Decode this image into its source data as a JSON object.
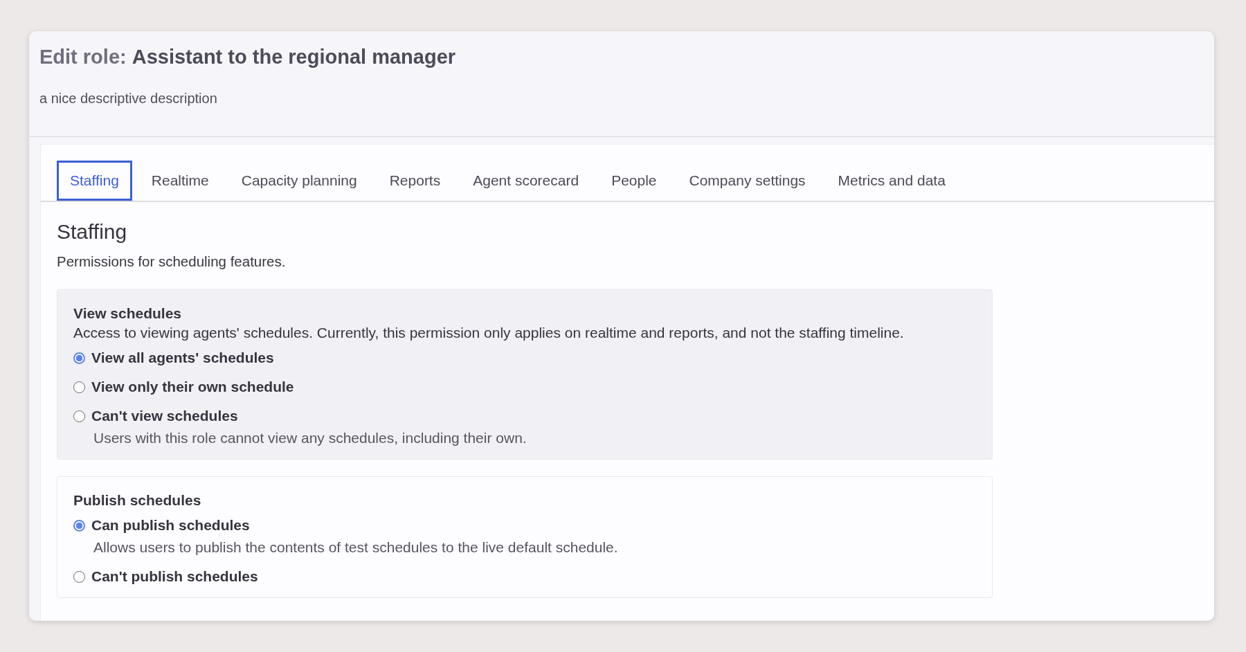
{
  "header": {
    "title": "Edit role: **Assistant to the regional manager**",
    "description": "a nice descriptive description"
  },
  "tabs": [
    {
      "label": "Staffing",
      "selected": true
    },
    {
      "label": "Realtime",
      "selected": false
    },
    {
      "label": "Capacity planning",
      "selected": false
    },
    {
      "label": "Reports",
      "selected": false
    },
    {
      "label": "Agent scorecard",
      "selected": false
    },
    {
      "label": "People",
      "selected": false
    },
    {
      "label": "Company settings",
      "selected": false
    },
    {
      "label": "Metrics and data",
      "selected": false
    }
  ],
  "section": {
    "heading": "Staffing",
    "description": "Permissions for scheduling features."
  },
  "permissions": [
    {
      "title": "View schedules",
      "description": "Access to viewing agents' schedules. Currently, this permission only applies on realtime and reports, and not the staffing timeline.",
      "highlighted": true,
      "options": [
        {
          "label": "View all agents' schedules",
          "selected": true
        },
        {
          "label": "View only their own schedule",
          "selected": false
        },
        {
          "label": "Can't view schedules",
          "selected": false,
          "description": "Users with this role cannot view any schedules, including their own."
        }
      ]
    },
    {
      "title": "Publish schedules",
      "highlighted": false,
      "options": [
        {
          "label": "Can publish schedules",
          "selected": true,
          "description": "Allows users to publish the contents of test schedules to the live default schedule."
        },
        {
          "label": "Can't publish schedules",
          "selected": false
        }
      ]
    }
  ]
}
